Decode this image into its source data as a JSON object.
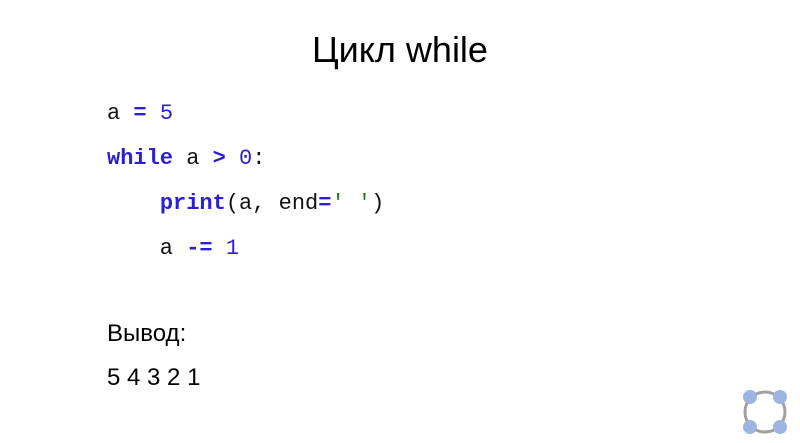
{
  "slide": {
    "title": "Цикл while",
    "code": {
      "line1": [
        "a ",
        "=",
        " ",
        "5"
      ],
      "line2": [
        "while",
        " a ",
        ">",
        " ",
        "0",
        ":"
      ],
      "line3": [
        "    ",
        "print",
        "(a, end",
        "=",
        "' '",
        ")"
      ],
      "line4": [
        "    a ",
        "-=",
        " ",
        "1"
      ]
    },
    "output_label": "Вывод:",
    "output_value": "5 4 3 2 1"
  },
  "colors": {
    "keyword": "#2a1fd1",
    "string": "#1f7a1f",
    "text": "#111111",
    "logo_dots": "#9db5e0",
    "logo_ring": "#a0a0a0"
  },
  "icons": {
    "logo": "circle-dots-logo-icon"
  }
}
